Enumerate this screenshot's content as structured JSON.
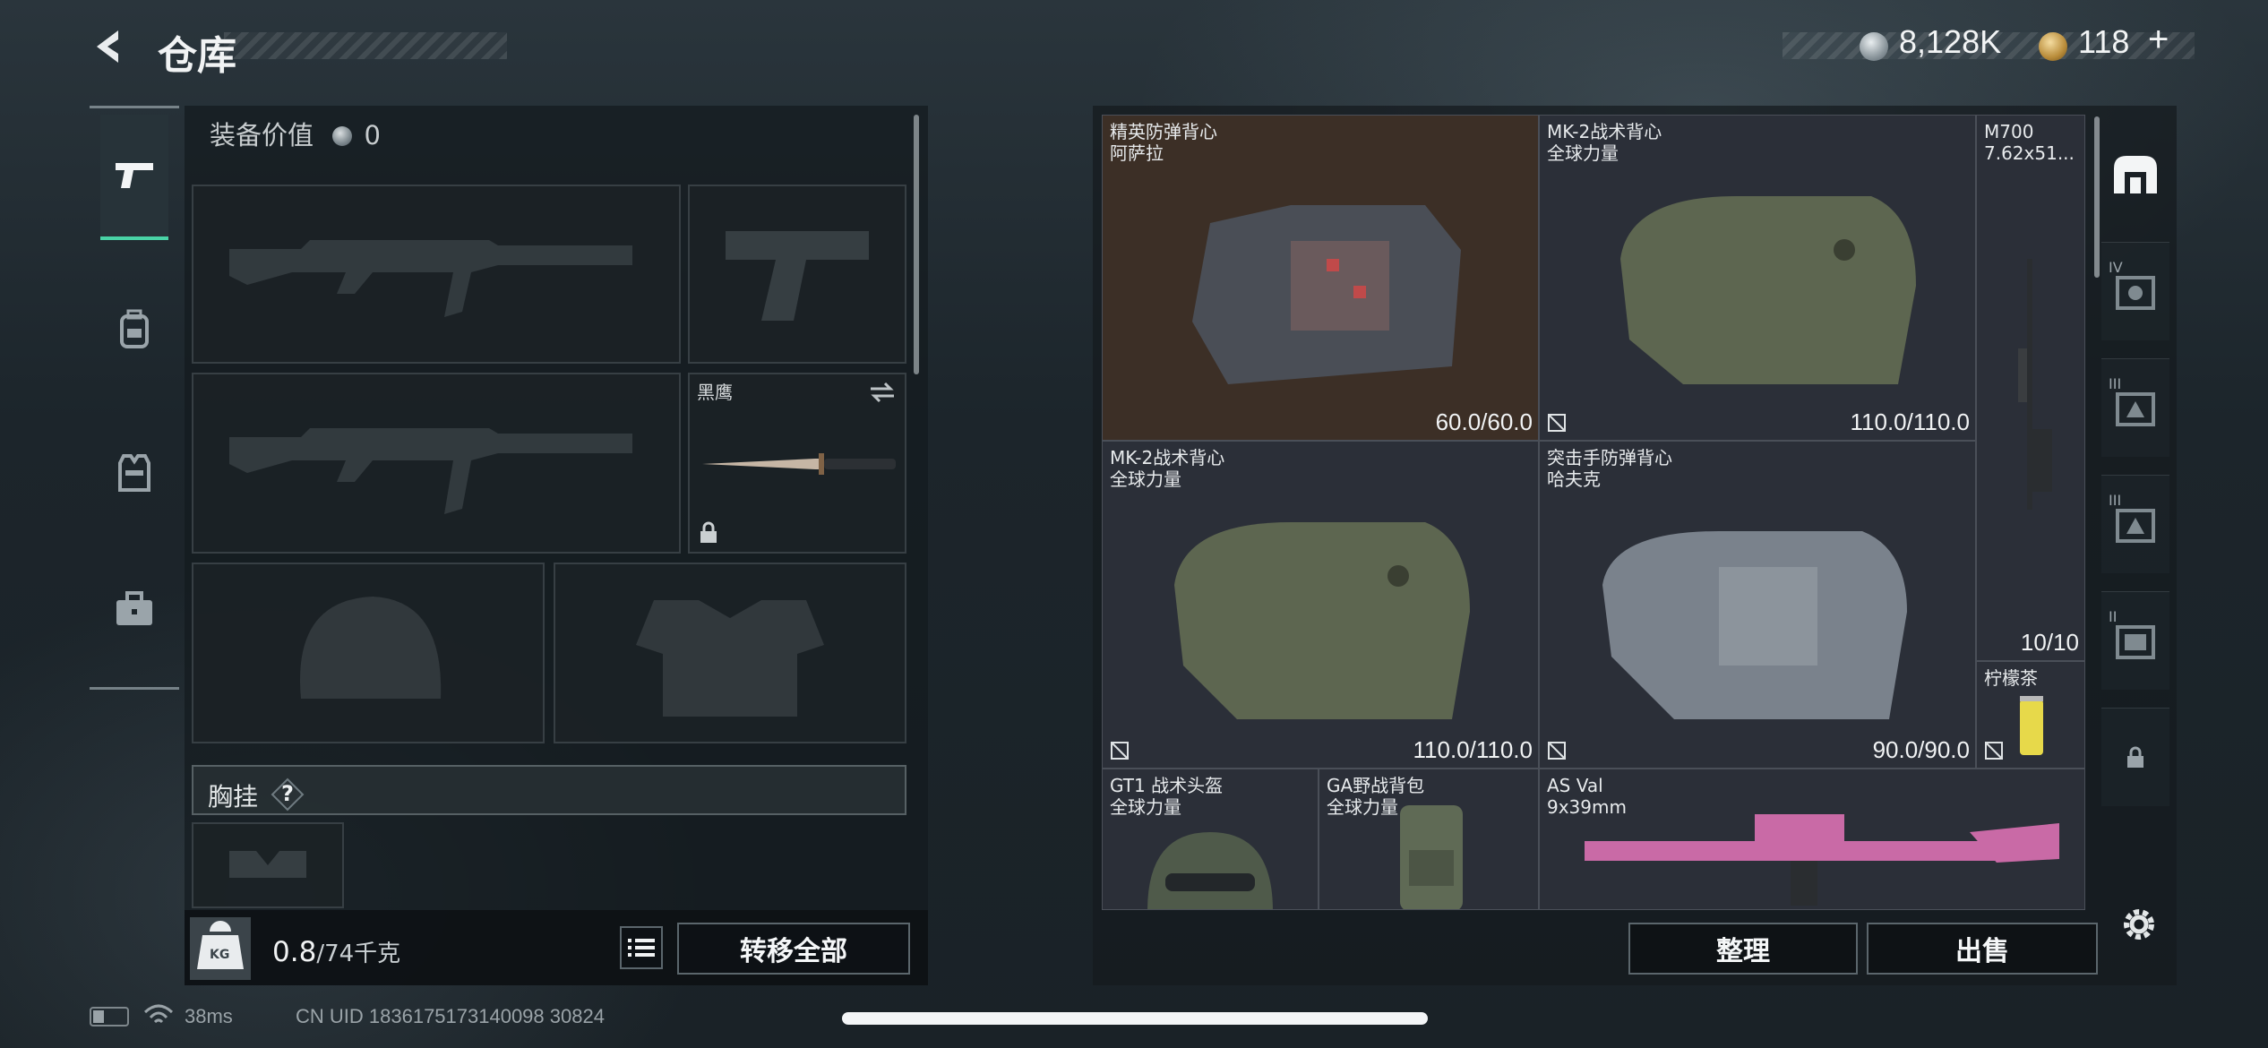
{
  "header": {
    "title": "仓库",
    "silver_amount": "8,128K",
    "gold_amount": "118",
    "gold_plus": "+"
  },
  "side_tabs": [
    {
      "icon": "pistol-icon",
      "active": true
    },
    {
      "icon": "backpack-icon",
      "active": false
    },
    {
      "icon": "vest-icon",
      "active": false
    },
    {
      "icon": "toolbox-icon",
      "active": false
    }
  ],
  "loadout": {
    "value_label": "装备价值",
    "value_amount": "0",
    "melee_name": "黑鹰",
    "chest_rig_label": "胸挂",
    "chest_rig_help": "?",
    "weight_current": "0.8",
    "weight_capacity": "/74千克",
    "kg_icon_label": "KG",
    "transfer_all": "转移全部"
  },
  "stash": {
    "items": [
      {
        "name": "精英防弹背心",
        "sub": "阿萨拉",
        "durability": "60.0/60.0"
      },
      {
        "name": "MK-2战术背心",
        "sub": "全球力量",
        "durability": "110.0/110.0"
      },
      {
        "name": "M700",
        "sub": "7.62x51..."
      },
      {
        "name": "MK-2战术背心",
        "sub": "全球力量",
        "durability": "110.0/110.0"
      },
      {
        "name": "突击手防弹背心",
        "sub": "哈夫克",
        "durability": "90.0/90.0"
      },
      {
        "name": "",
        "sub": "",
        "count": "10/10"
      },
      {
        "name": "柠檬茶",
        "sub": ""
      },
      {
        "name": "GT1 战术头盔",
        "sub": "全球力量"
      },
      {
        "name": "GA野战背包",
        "sub": "全球力量"
      },
      {
        "name": "AS Val",
        "sub": "9x39mm"
      }
    ],
    "sort": "整理",
    "sell": "出售"
  },
  "rail": {
    "tiers": [
      "IV",
      "III",
      "III",
      "II"
    ]
  },
  "status_bar": {
    "ping": "38ms",
    "uid": "CN UID 1836175173140098 30824"
  },
  "colors": {
    "accent": "#49d3a6",
    "gold_item_bg": "#3c2f26",
    "item_bg": "#2b2f38"
  }
}
